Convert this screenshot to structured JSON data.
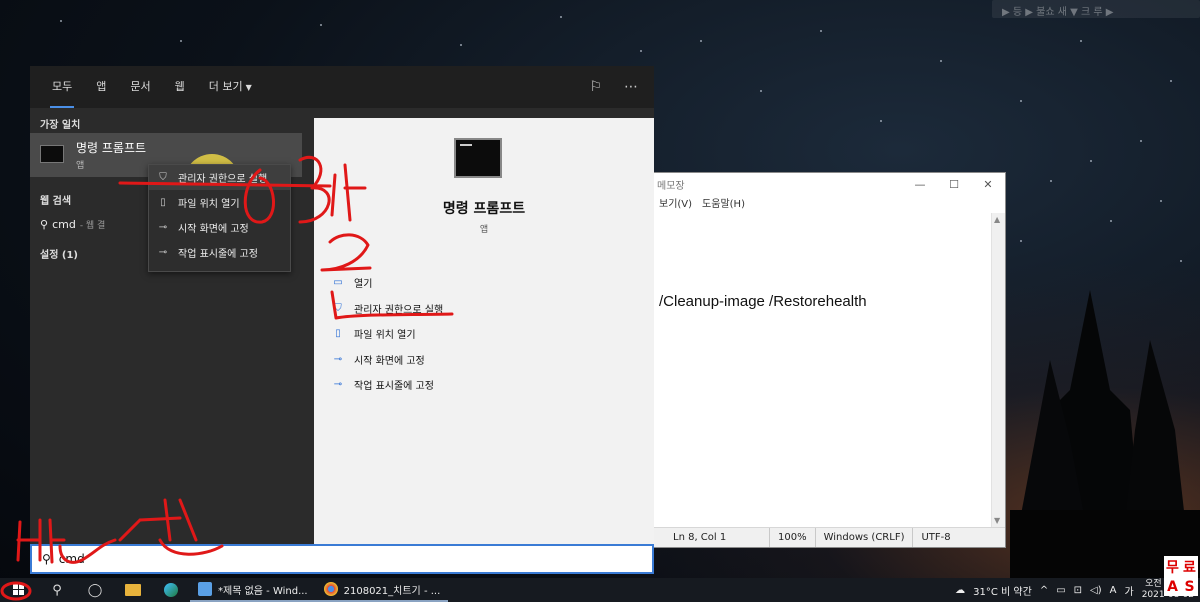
{
  "top_banner": "▶ 등 ▶ 불쇼 새 ▼ 크 루 ▶",
  "notepad": {
    "title": "메모장",
    "controls": [
      "—",
      "☐",
      "✕"
    ],
    "menu": [
      "보기(V)",
      "도움말(H)"
    ],
    "content": "/Cleanup-image /Restorehealth",
    "status": {
      "position": "Ln 8, Col 1",
      "zoom": "100%",
      "line_ending": "Windows (CRLF)",
      "encoding": "UTF-8"
    }
  },
  "search_panel": {
    "tabs": [
      "모두",
      "앱",
      "문서",
      "웹",
      "더 보기"
    ],
    "best_match_label": "가장 일치",
    "best_match": {
      "name": "명령 프롬프트",
      "type": "앱"
    },
    "web_search_label": "웹 검색",
    "web_search": {
      "query": "cmd",
      "hint": "- 웹 결"
    },
    "settings_label": "설정 (1)",
    "context_menu": [
      "관리자 권한으로 실행",
      "파일 위치 열기",
      "시작 화면에 고정",
      "작업 표시줄에 고정"
    ],
    "detail": {
      "title": "명령 프롬프트",
      "subtitle": "앱",
      "actions": [
        "열기",
        "관리자 권한으로 실행",
        "파일 위치 열기",
        "시작 화면에 고정",
        "작업 표시줄에 고정"
      ]
    },
    "search_query": "cmd"
  },
  "taskbar": {
    "apps": [
      {
        "label": "*제목 없음 - Wind...",
        "color": "#5aa0e6"
      },
      {
        "label": "2108021_치트기 - ...",
        "color": "#e0a020"
      }
    ],
    "weather": "31°C  비 약간",
    "ime": "A",
    "ime2": "가",
    "time": "오전 11:18",
    "date": "2021-08-02"
  },
  "badge": [
    "무",
    "료",
    "A",
    "S"
  ],
  "annotations": [
    "3번",
    "2",
    "1번",
    "2번"
  ]
}
